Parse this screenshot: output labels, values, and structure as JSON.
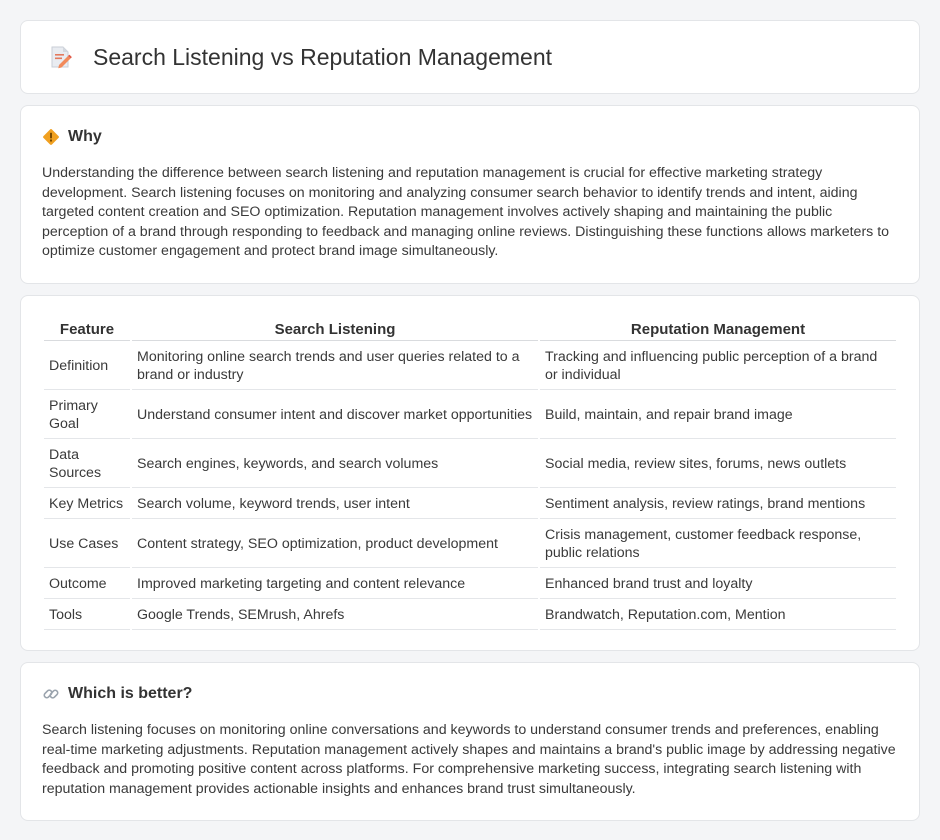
{
  "page": {
    "title": "Search Listening vs Reputation Management"
  },
  "why": {
    "title": "Why",
    "text": "Understanding the difference between search listening and reputation management is crucial for effective marketing strategy development. Search listening focuses on monitoring and analyzing consumer search behavior to identify trends and intent, aiding targeted content creation and SEO optimization. Reputation management involves actively shaping and maintaining the public perception of a brand through responding to feedback and managing online reviews. Distinguishing these functions allows marketers to optimize customer engagement and protect brand image simultaneously."
  },
  "table": {
    "headers": [
      "Feature",
      "Search Listening",
      "Reputation Management"
    ],
    "rows": [
      [
        "Definition",
        "Monitoring online search trends and user queries related to a brand or industry",
        "Tracking and influencing public perception of a brand or individual"
      ],
      [
        "Primary Goal",
        "Understand consumer intent and discover market opportunities",
        "Build, maintain, and repair brand image"
      ],
      [
        "Data Sources",
        "Search engines, keywords, and search volumes",
        "Social media, review sites, forums, news outlets"
      ],
      [
        "Key Metrics",
        "Search volume, keyword trends, user intent",
        "Sentiment analysis, review ratings, brand mentions"
      ],
      [
        "Use Cases",
        "Content strategy, SEO optimization, product development",
        "Crisis management, customer feedback response, public relations"
      ],
      [
        "Outcome",
        "Improved marketing targeting and content relevance",
        "Enhanced brand trust and loyalty"
      ],
      [
        "Tools",
        "Google Trends, SEMrush, Ahrefs",
        "Brandwatch, Reputation.com, Mention"
      ]
    ]
  },
  "better": {
    "title": "Which is better?",
    "text": "Search listening focuses on monitoring online conversations and keywords to understand consumer trends and preferences, enabling real-time marketing adjustments. Reputation management actively shapes and maintains a brand's public image by addressing negative feedback and promoting positive content across platforms. For comprehensive marketing success, integrating search listening with reputation management provides actionable insights and enhances brand trust simultaneously."
  },
  "icons": {
    "title": "document-pencil-icon",
    "why": "diamond-warning-icon",
    "better": "link-icon"
  },
  "colors": {
    "background": "#f4f5f7",
    "card": "#ffffff",
    "accent_orange": "#f0a020"
  }
}
